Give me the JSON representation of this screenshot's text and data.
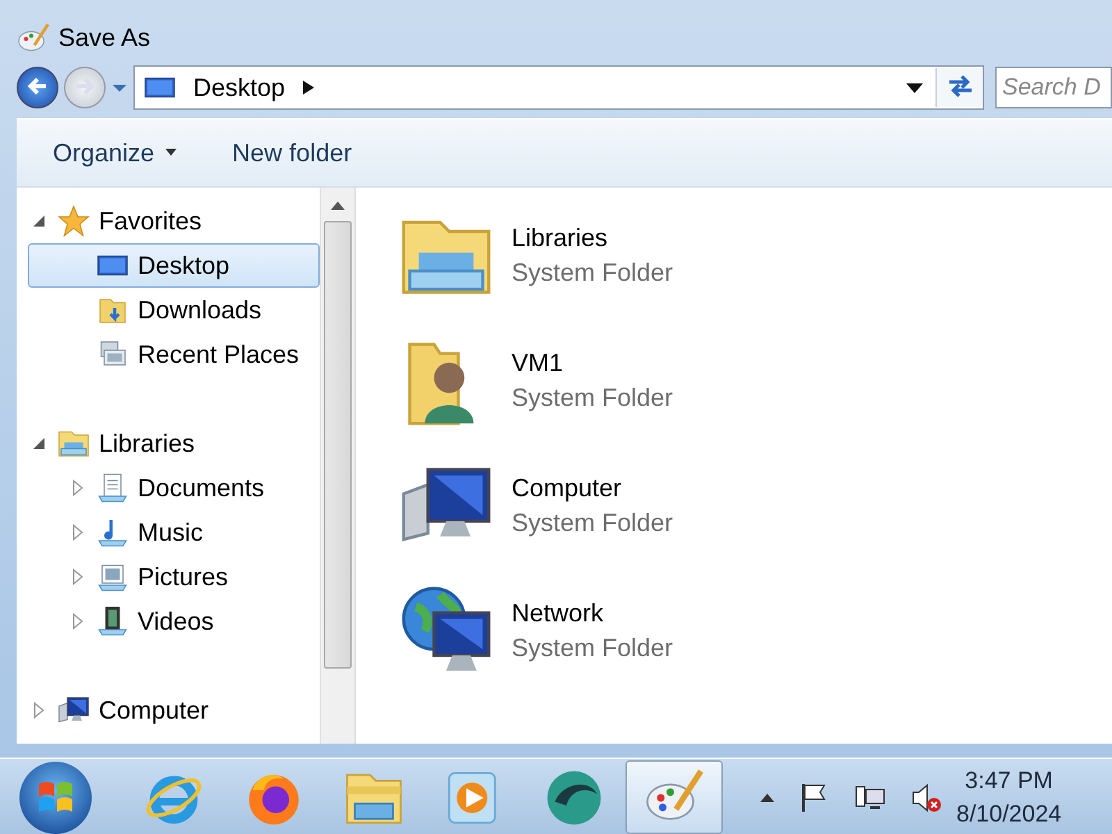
{
  "window": {
    "title": "Save As"
  },
  "address": {
    "location": "Desktop",
    "search_placeholder": "Search D"
  },
  "toolbar": {
    "organize": "Organize",
    "new_folder": "New folder"
  },
  "nav": [
    {
      "label": "Favorites",
      "kind": "star",
      "expanded": true,
      "selected": false,
      "children": [
        {
          "label": "Desktop",
          "kind": "desktop",
          "selected": true
        },
        {
          "label": "Downloads",
          "kind": "downloads",
          "selected": false
        },
        {
          "label": "Recent Places",
          "kind": "recent",
          "selected": false
        }
      ]
    },
    {
      "label": "Libraries",
      "kind": "libraries",
      "expanded": true,
      "selected": false,
      "children": [
        {
          "label": "Documents",
          "kind": "documents",
          "expanded": false,
          "selected": false
        },
        {
          "label": "Music",
          "kind": "music",
          "expanded": false,
          "selected": false
        },
        {
          "label": "Pictures",
          "kind": "pictures",
          "expanded": false,
          "selected": false
        },
        {
          "label": "Videos",
          "kind": "videos",
          "expanded": false,
          "selected": false
        }
      ]
    },
    {
      "label": "Computer",
      "kind": "computer",
      "expanded": false,
      "selected": false
    }
  ],
  "items": [
    {
      "name": "Libraries",
      "type": "System Folder",
      "kind": "libraries"
    },
    {
      "name": "VM1",
      "type": "System Folder",
      "kind": "user"
    },
    {
      "name": "Computer",
      "type": "System Folder",
      "kind": "computer"
    },
    {
      "name": "Network",
      "type": "System Folder",
      "kind": "network"
    }
  ],
  "taskbar": {
    "apps": [
      {
        "kind": "ie",
        "selected": false
      },
      {
        "kind": "firefox",
        "selected": false
      },
      {
        "kind": "explorer",
        "selected": false
      },
      {
        "kind": "media",
        "selected": false
      },
      {
        "kind": "swirl",
        "selected": false
      },
      {
        "kind": "paint",
        "selected": true
      }
    ],
    "clock": {
      "time": "3:47 PM",
      "date": "8/10/2024"
    }
  }
}
